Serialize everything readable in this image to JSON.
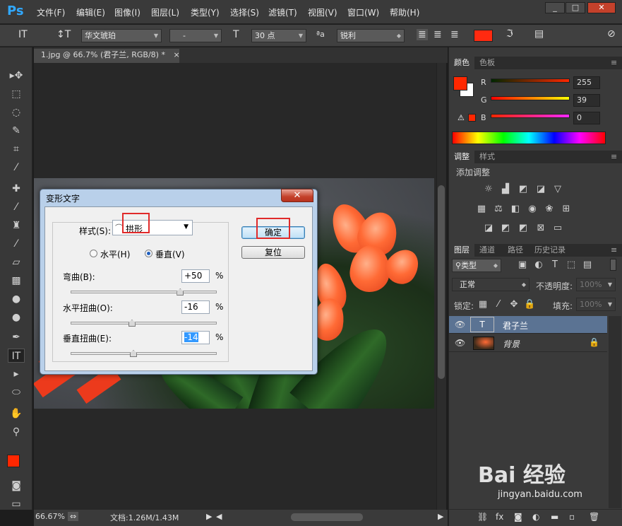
{
  "app": {
    "logo": "Ps"
  },
  "menu": [
    "文件(F)",
    "编辑(E)",
    "图像(I)",
    "图层(L)",
    "类型(Y)",
    "选择(S)",
    "滤镜(T)",
    "视图(V)",
    "窗口(W)",
    "帮助(H)"
  ],
  "window_controls": {
    "minimize": "_",
    "restore": "□",
    "close": "✕"
  },
  "options": {
    "font_family": "华文琥珀",
    "font_style": "-",
    "font_size": "30 点",
    "aa_label": "ªa",
    "anti_alias": "锐利",
    "text_color": "#ff2a10"
  },
  "document": {
    "tab_title": "1.jpg @ 66.7% (君子兰, RGB/8) *",
    "close": "×"
  },
  "status": {
    "zoom": "66.67%",
    "doc_size": "文档:1.26M/1.43M"
  },
  "color_panel": {
    "tabs": [
      "颜色",
      "色板"
    ],
    "r": "255",
    "g": "39",
    "b": "0",
    "fg_color": "#ff2700",
    "bg_color": "#ffffff"
  },
  "adjust_panel": {
    "tabs": [
      "调整",
      "样式"
    ],
    "title": "添加调整"
  },
  "layers_panel": {
    "tabs": [
      "图层",
      "通道",
      "路径",
      "历史记录"
    ],
    "filter": "类型",
    "blend_mode": "正常",
    "opacity_label": "不透明度:",
    "opacity": "100%",
    "lock_label": "锁定:",
    "fill_label": "填充:",
    "fill": "100%",
    "layers": [
      {
        "name": "君子兰",
        "type": "text"
      },
      {
        "name": "背景",
        "type": "image"
      }
    ]
  },
  "dialog": {
    "title": "变形文字",
    "style_label": "样式(S):",
    "style_value": "拱形",
    "horizontal_label": "水平(H)",
    "vertical_label": "垂直(V)",
    "selected_orientation": "vertical",
    "bend_label": "弯曲(B):",
    "bend_value": "+50",
    "bend_level": 50,
    "hdist_label": "水平扭曲(O):",
    "hdist_value": "-16",
    "hdist_level": -16,
    "vdist_label": "垂直扭曲(E):",
    "vdist_value": "-14",
    "vdist_level": -14,
    "percent": "%",
    "ok_label": "确定",
    "reset_label": "复位"
  },
  "watermark": {
    "brand": "Bai 经验",
    "url": "jingyan.baidu.com"
  }
}
